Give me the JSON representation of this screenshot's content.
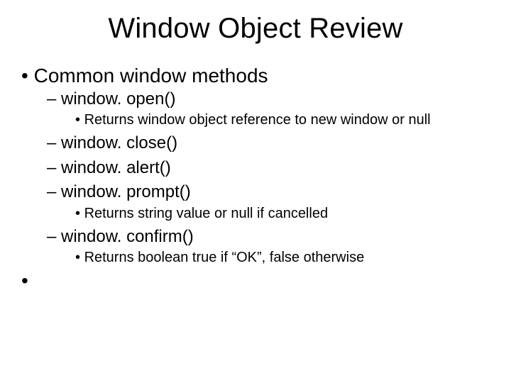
{
  "title": "Window Object Review",
  "l1_item": "Common window methods",
  "methods": {
    "open": "window. open()",
    "open_note": "Returns window object reference to new window or null",
    "close": "window. close()",
    "alert": "window. alert()",
    "prompt": "window. prompt()",
    "prompt_note": "Returns string value or null if cancelled",
    "confirm": "window. confirm()",
    "confirm_note": "Returns boolean true if “OK”, false otherwise"
  },
  "blank_bullet": "•"
}
